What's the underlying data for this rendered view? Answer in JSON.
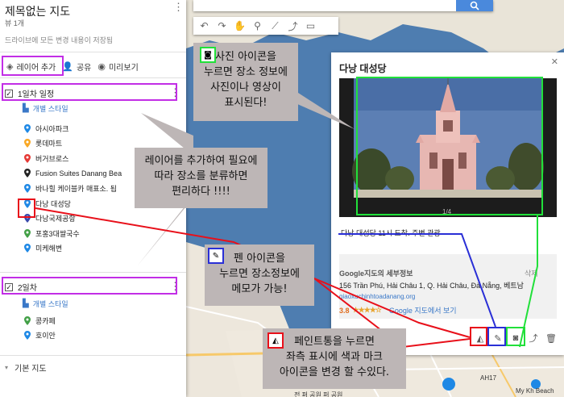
{
  "map": {
    "search": {
      "button_icon": "search-icon"
    },
    "toolbar": {
      "tools": [
        "undo-icon",
        "redo-icon",
        "hand-icon",
        "marker-icon",
        "line-icon",
        "route-icon",
        "ruler-icon"
      ]
    },
    "pois": [
      "AH17",
      "My Kh Beach"
    ],
    "footer_text": "전 퍼 공원  퍼 공원"
  },
  "panel": {
    "title": "제목없는 지도",
    "views": "뷰 1개",
    "save_status": "드라이브에 모든 변경 내용이 저장됨",
    "actions": {
      "add_layer": "레이어 추가",
      "share": "공유",
      "preview": "미리보기"
    },
    "layer1": {
      "name": "1일차 일정",
      "style_link": "개별 스타일",
      "places": [
        {
          "name": "아시아파크",
          "color": "#1e88e5"
        },
        {
          "name": "롯데마트",
          "color": "#f9a825"
        },
        {
          "name": "버거브로스",
          "color": "#e53935"
        },
        {
          "name": "Fusion Suites Danang Bea",
          "color": "#222222"
        },
        {
          "name": "바나힐 케이블카 매표소. 됩",
          "color": "#1e88e5"
        },
        {
          "name": "다낭 대성당",
          "color": "#1e88e5"
        },
        {
          "name": "다낭국제공항",
          "color": "#3949ab"
        },
        {
          "name": "포홍3대쌀국수",
          "color": "#43a047"
        },
        {
          "name": "미케해변",
          "color": "#1e88e5"
        }
      ]
    },
    "layer2": {
      "name": "2일차",
      "style_link": "개별 스타일",
      "places": [
        {
          "name": "콩카페",
          "color": "#43a047"
        },
        {
          "name": "호이안",
          "color": "#1e88e5"
        }
      ]
    },
    "base_map": "기본 지도"
  },
  "card": {
    "title": "다낭 대성당",
    "photo_counter": "1/4",
    "description": "다낭 대성당 11시 도착. 주변 관광",
    "info_heading": "Google지도의 세부정보",
    "delete_label": "삭제",
    "address": "156 Trần Phú, Hải Châu 1, Q. Hải Châu, Đà Nẵng, 베트남",
    "website": "giaoxuchinhtoadanang.org",
    "rating": "3.8",
    "stars": "★★★★☆",
    "reviews": "Google 지도에서 보기",
    "tools": [
      "paint-bucket-icon",
      "pen-icon",
      "camera-icon",
      "directions-icon",
      "trash-icon"
    ]
  },
  "annotations": {
    "camera_note": [
      "사진 아이콘을",
      "누르면 장소 정보에",
      "사진이나 영상이",
      "표시된다!"
    ],
    "layer_note": [
      "레이어를 추가하여 필요에",
      "따라 장소를 분류하면",
      "편리하다 !!!!"
    ],
    "pen_note": [
      "펜 아이콘을",
      "누르면 장소정보에",
      "메모가 가능!"
    ],
    "paint_note": [
      "페인트통을 누르면",
      "좌측 표시에 색과 마크",
      "아이콘을 변경 할 수있다."
    ],
    "colors": {
      "purple": "#c22ee6",
      "red": "#e8101a",
      "blue": "#2a2fd6",
      "green": "#21e03a"
    }
  }
}
